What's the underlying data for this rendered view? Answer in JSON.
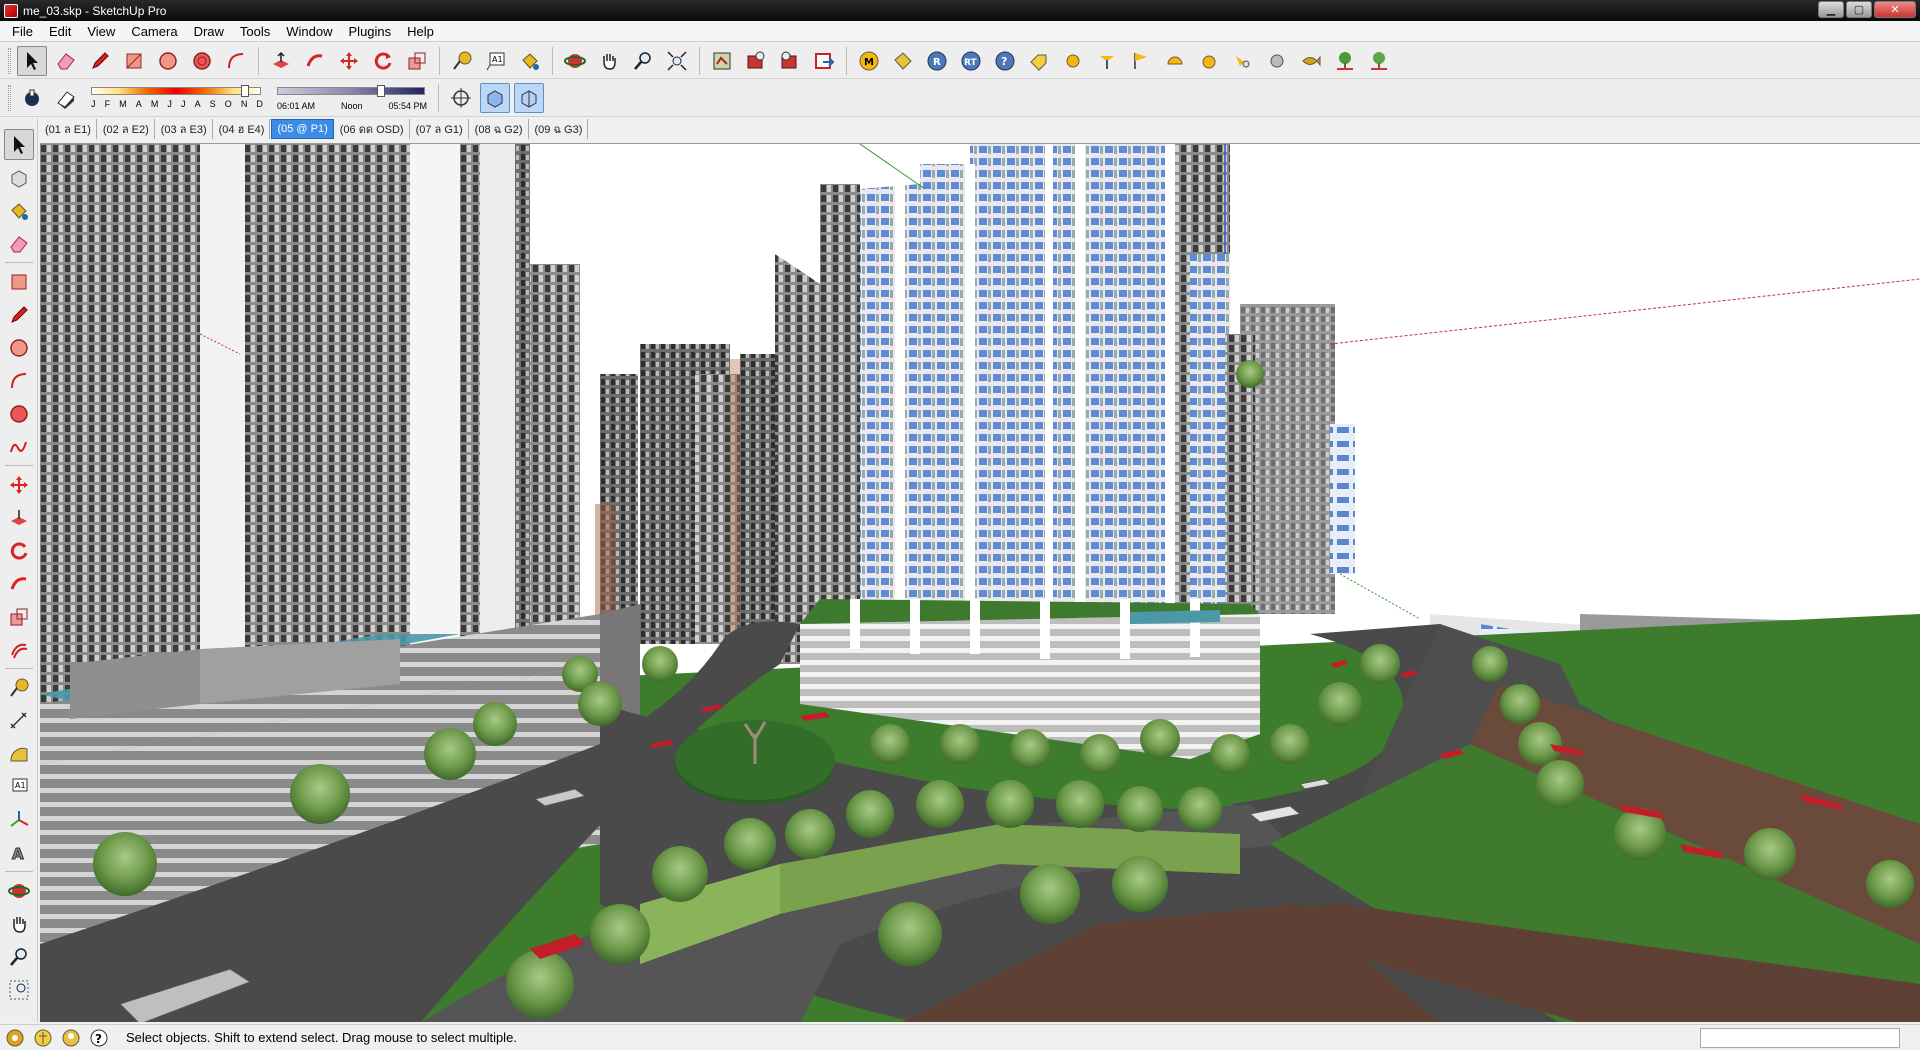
{
  "window": {
    "title": "me_03.skp - SketchUp Pro"
  },
  "menu": [
    "File",
    "Edit",
    "View",
    "Camera",
    "Draw",
    "Tools",
    "Window",
    "Plugins",
    "Help"
  ],
  "toolbar_top": [
    "select-arrow-icon",
    "eraser-icon",
    "pencil-icon",
    "rectangle-icon",
    "circle-icon",
    "polygon-icon",
    "arc-icon",
    "push-pull-icon",
    "follow-me-icon",
    "move-icon",
    "rotate-icon",
    "scale-icon",
    "tape-measure-icon",
    "text-icon",
    "paint-bucket-icon",
    "orbit-icon",
    "pan-hand-icon",
    "zoom-icon",
    "zoom-extents-icon",
    "get-models-icon",
    "share-model-icon",
    "share-component-icon",
    "send-to-layout-icon",
    "plugin-m-icon",
    "plugin-tag-icon",
    "plugin-r-icon",
    "plugin-rt-icon",
    "plugin-help-icon",
    "plugin-label-icon",
    "plugin-sphere-icon",
    "plugin-light-icon",
    "plugin-flag-icon",
    "plugin-halfdome-icon",
    "plugin-ball-icon",
    "plugin-spot-icon",
    "plugin-globe-icon",
    "plugin-fish-icon",
    "plugin-tree-icon",
    "plugin-tree2-icon"
  ],
  "shadow": {
    "months": [
      "J",
      "F",
      "M",
      "A",
      "M",
      "J",
      "J",
      "A",
      "S",
      "O",
      "N",
      "D"
    ],
    "time_start": "06:01 AM",
    "time_mid": "Noon",
    "time_end": "05:54 PM"
  },
  "tabs": [
    {
      "label": "(01 ล E1)",
      "active": false
    },
    {
      "label": "(02 ล E2)",
      "active": false
    },
    {
      "label": "(03 ล E3)",
      "active": false
    },
    {
      "label": "(04 ฮ E4)",
      "active": false
    },
    {
      "label": "(05 @ P1)",
      "active": true
    },
    {
      "label": "(06 ดด OSD)",
      "active": false
    },
    {
      "label": "(07 ล G1)",
      "active": false
    },
    {
      "label": "(08 ฉ G2)",
      "active": false
    },
    {
      "label": "(09 ฉ G3)",
      "active": false
    }
  ],
  "status": {
    "hint": "Select objects. Shift to extend select. Drag mouse to select multiple."
  },
  "colors": {
    "accent": "#3c8ce6",
    "road": "#4a4a4a",
    "grass": "#3f7a2e",
    "building_glass": "#6f97d8"
  }
}
